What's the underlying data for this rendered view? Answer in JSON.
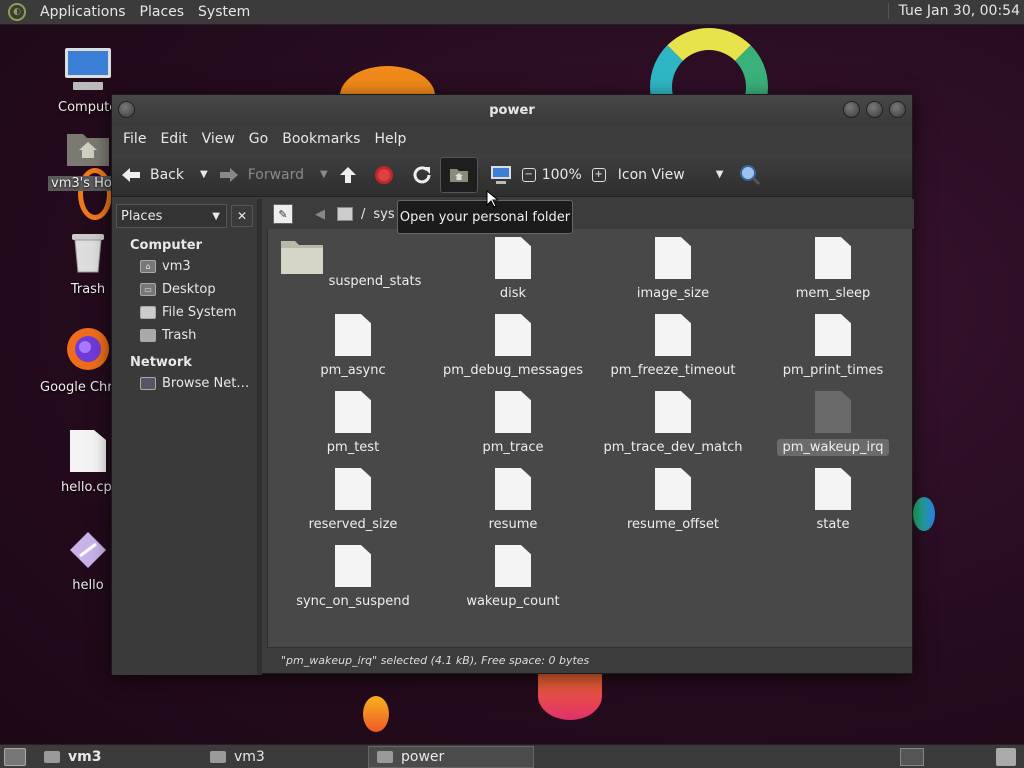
{
  "topbar": {
    "menus": [
      "Applications",
      "Places",
      "System"
    ],
    "clock": "Tue Jan 30, 00:54"
  },
  "desktop": {
    "icons": [
      "Compute",
      "vm3's Ho",
      "Trash",
      "Google Chr",
      "hello.cp",
      "hello"
    ]
  },
  "window": {
    "title": "power",
    "menu": [
      "File",
      "Edit",
      "View",
      "Go",
      "Bookmarks",
      "Help"
    ],
    "toolbar": {
      "back": "Back",
      "forward": "Forward",
      "zoom": "100%",
      "view_mode": "Icon View"
    },
    "tooltip": "Open your personal folder",
    "pathbar": {
      "root": "/",
      "segment": "sys"
    },
    "sidebar": {
      "title": "Places",
      "sections": [
        {
          "name": "Computer",
          "items": [
            "vm3",
            "Desktop",
            "File System",
            "Trash"
          ]
        },
        {
          "name": "Network",
          "items": [
            "Browse Net…"
          ]
        }
      ]
    },
    "files": [
      "suspend_stats",
      "disk",
      "image_size",
      "mem_sleep",
      "pm_async",
      "pm_debug_messages",
      "pm_freeze_timeout",
      "pm_print_times",
      "pm_test",
      "pm_trace",
      "pm_trace_dev_match",
      "pm_wakeup_irq",
      "reserved_size",
      "resume",
      "resume_offset",
      "state",
      "sync_on_suspend",
      "wakeup_count"
    ],
    "selected": "pm_wakeup_irq",
    "status": "\"pm_wakeup_irq\" selected (4.1 kB), Free space: 0 bytes"
  },
  "taskbar": {
    "items": [
      "vm3",
      "vm3",
      "power"
    ]
  }
}
